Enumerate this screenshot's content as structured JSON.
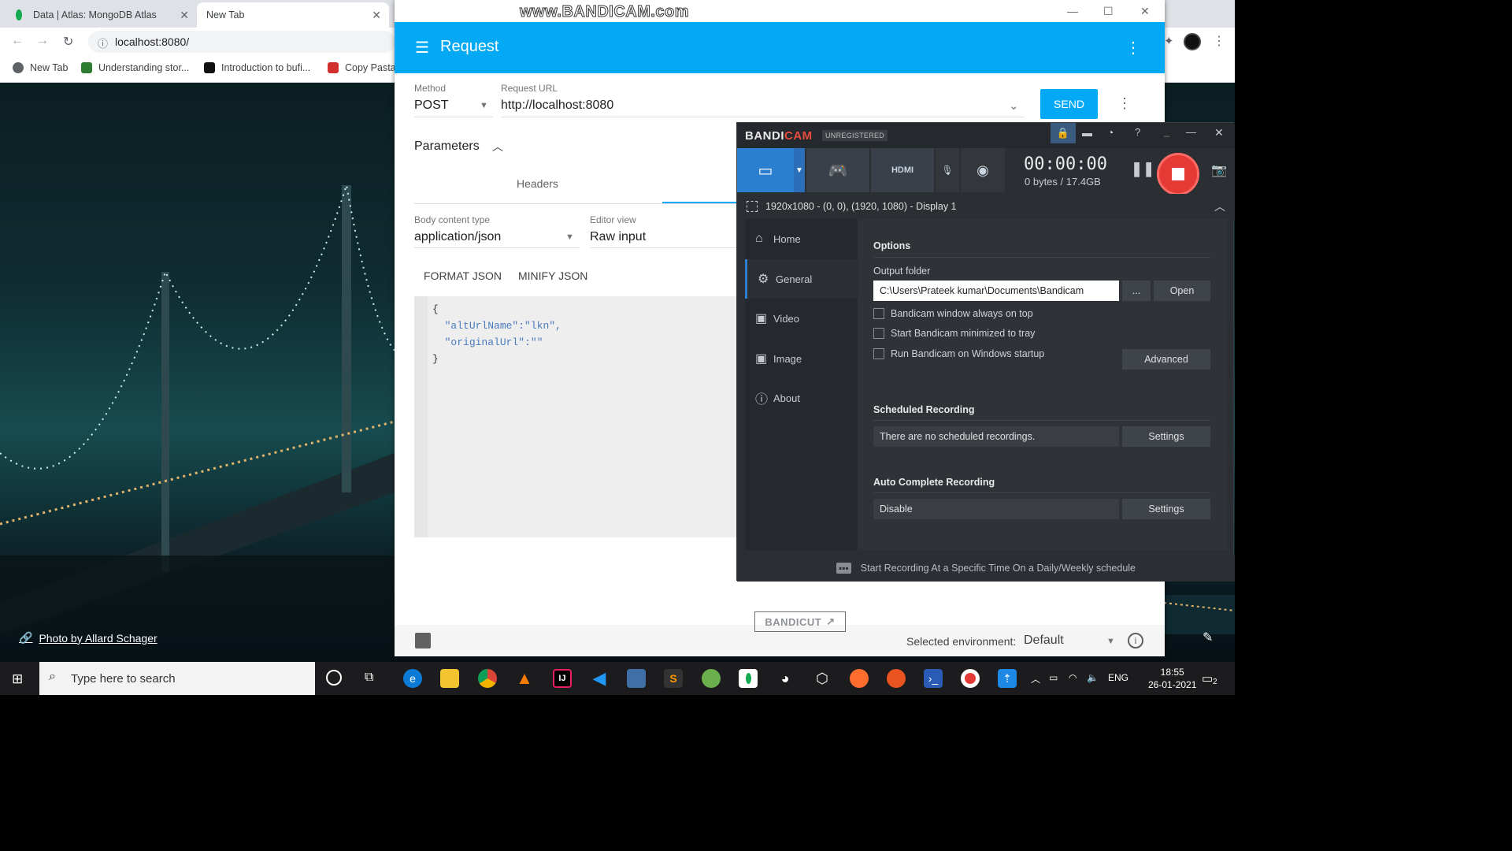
{
  "watermark": "www.BANDICAM.com",
  "chrome": {
    "tabs": [
      {
        "title": "Data | Atlas: MongoDB Atlas"
      },
      {
        "title": "New Tab"
      }
    ],
    "url": "localhost:8080/",
    "bookmarks": [
      "New Tab",
      "Understanding stor...",
      "Introduction to bufi...",
      "Copy Pasta"
    ]
  },
  "wallpaper": {
    "credit": "Photo by Allard Schager"
  },
  "rester": {
    "title": "Request",
    "method_label": "Method",
    "method": "POST",
    "url_label": "Request URL",
    "url": "http://localhost:8080",
    "send_label": "SEND",
    "parameters_label": "Parameters",
    "headers_tab": "Headers",
    "body_type_label": "Body content type",
    "body_type": "application/json",
    "editor_view_label": "Editor view",
    "editor_view": "Raw input",
    "format_json": "FORMAT JSON",
    "minify_json": "MINIFY JSON",
    "body_lines": {
      "open": "{",
      "k1": "\"altUrlName\"",
      "v1": ":\"lkn\",",
      "k2": "\"originalUrl\"",
      "v2": ":\"\"",
      "close": "}"
    },
    "env_label": "Selected environment:",
    "env_value": "Default"
  },
  "bandicam": {
    "logo_a": "BANDI",
    "logo_b": "CAM",
    "unregistered": "UNREGISTERED",
    "timer": "00:00:00",
    "bytes": "0 bytes / 17.4GB",
    "target": "1920x1080 - (0, 0), (1920, 1080) - Display 1",
    "sidebar": [
      "Home",
      "General",
      "Video",
      "Image",
      "About"
    ],
    "bandicut": "BANDICUT",
    "options_title": "Options",
    "output_folder_label": "Output folder",
    "output_folder": "C:\\Users\\Prateek kumar\\Documents\\Bandicam",
    "browse_label": "...",
    "open_label": "Open",
    "checkboxes": [
      "Bandicam window always on top",
      "Start Bandicam minimized to tray",
      "Run Bandicam on Windows startup"
    ],
    "advanced_label": "Advanced",
    "scheduled_title": "Scheduled Recording",
    "scheduled_text": "There are no scheduled recordings.",
    "settings_label": "Settings",
    "autocomplete_title": "Auto Complete Recording",
    "autocomplete_value": "Disable",
    "footer": "Start Recording At a Specific Time On a Daily/Weekly schedule"
  },
  "taskbar": {
    "search_placeholder": "Type here to search",
    "lang": "ENG",
    "time": "18:55",
    "date": "26-01-2021",
    "notif_count": "2"
  }
}
